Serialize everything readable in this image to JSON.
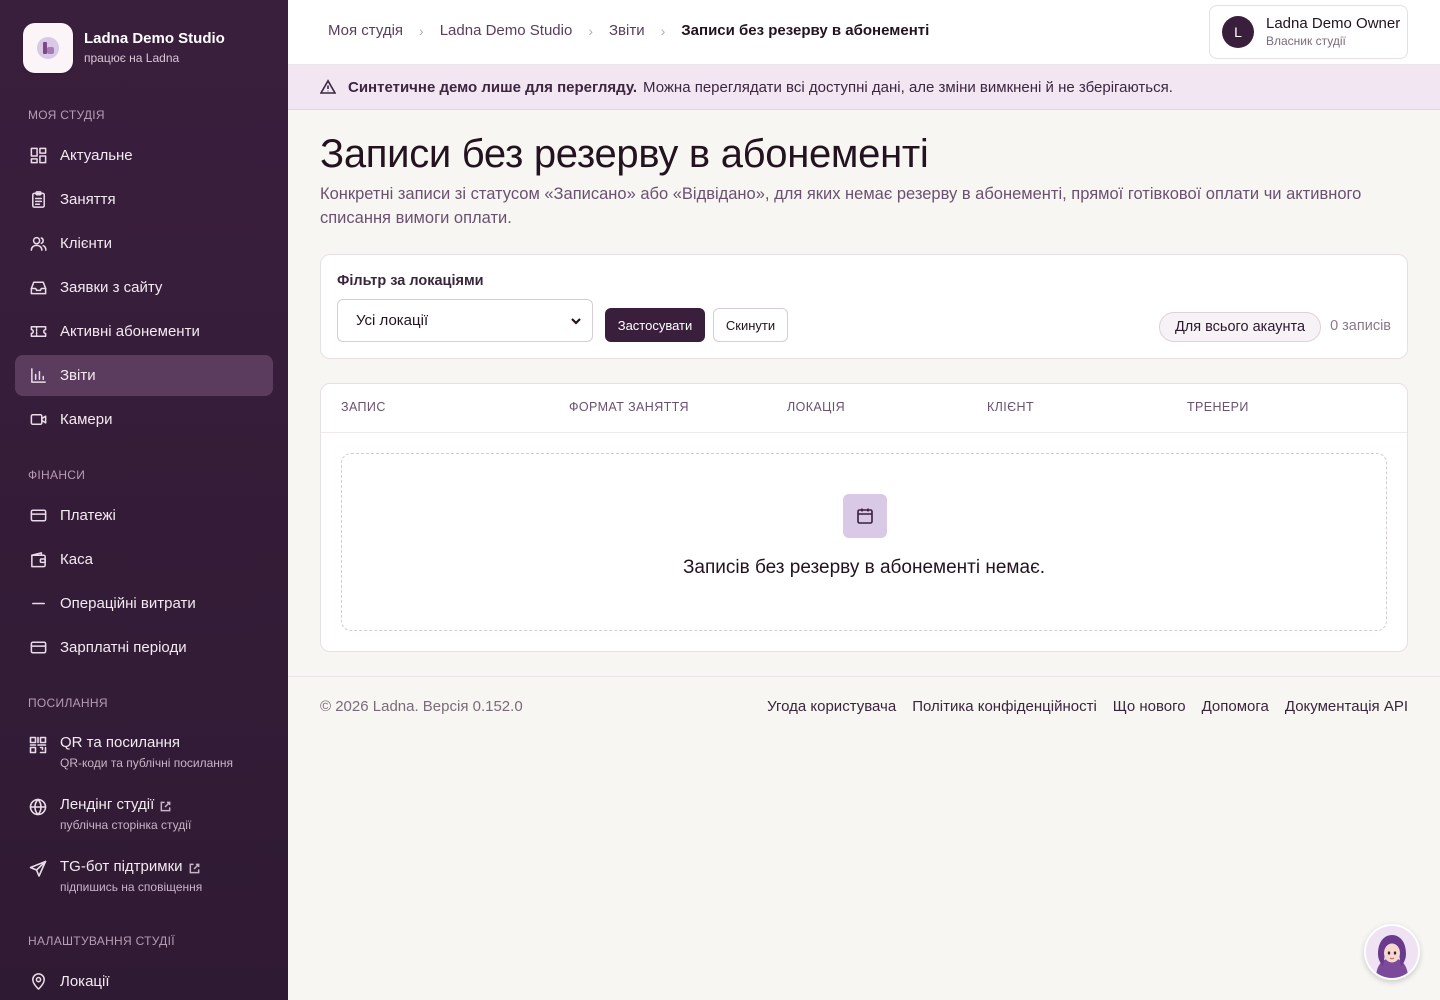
{
  "brand": {
    "name": "Ladna Demo Studio",
    "subtitle": "працює на Ladna"
  },
  "sidebar": {
    "sections": [
      {
        "title": "Моя студія"
      },
      {
        "title": "Фінанси"
      },
      {
        "title": "Посилання"
      },
      {
        "title": "Налаштування студії"
      }
    ],
    "items": [
      {
        "label": "Актуальне",
        "icon": "dashboard-icon"
      },
      {
        "label": "Заняття",
        "icon": "clipboard-icon"
      },
      {
        "label": "Клієнти",
        "icon": "users-icon"
      },
      {
        "label": "Заявки з сайту",
        "icon": "inbox-icon"
      },
      {
        "label": "Активні абонементи",
        "icon": "ticket-icon"
      },
      {
        "label": "Звіти",
        "icon": "bar-chart-icon",
        "active": true
      },
      {
        "label": "Камери",
        "icon": "video-icon"
      },
      {
        "label": "Платежі",
        "icon": "credit-card-icon"
      },
      {
        "label": "Каса",
        "icon": "wallet-icon"
      },
      {
        "label": "Операційні витрати",
        "icon": "minus-icon"
      },
      {
        "label": "Зарплатні періоди",
        "icon": "card-icon"
      },
      {
        "label": "Локації",
        "icon": "map-pin-icon"
      }
    ],
    "links": [
      {
        "label": "QR та посилання",
        "sub": "QR-коди та публічні посилання",
        "icon": "qr-icon"
      },
      {
        "label": "Лендінг студії",
        "sub": "публічна сторінка студії",
        "icon": "globe-icon"
      },
      {
        "label": "TG-бот підтримки",
        "sub": "підпишись на сповіщення",
        "icon": "send-icon"
      }
    ]
  },
  "breadcrumbs": [
    "Моя студія",
    "Ladna Demo Studio",
    "Звіти",
    "Записи без резерву в абонементі"
  ],
  "user": {
    "initial": "L",
    "name": "Ladna Demo Owner",
    "role": "Власник студії"
  },
  "banner": {
    "bold": "Синтетичне демо лише для перегляду.",
    "text": "Можна переглядати всі доступні дані, але зміни вимкнені й не зберігаються."
  },
  "page": {
    "title": "Записи без резерву в абонементі",
    "description": "Конкретні записи зі статусом «Записано» або «Відвідано», для яких немає резерву в абонементі, прямої готівкової оплати чи активного списання вимоги оплати."
  },
  "filter": {
    "label": "Фільтр за локаціями",
    "select_value": "Усі локації",
    "apply_label": "Застосувати",
    "reset_label": "Скинути",
    "scope_badge": "Для всього акаунта",
    "count": "0 записів"
  },
  "table": {
    "columns": [
      "Запис",
      "Формат заняття",
      "Локація",
      "Клієнт",
      "Тренери"
    ],
    "empty_text": "Записів без резерву в абонементі немає."
  },
  "footer": {
    "copyright": "© 2026 Ladna. Версія 0.152.0",
    "links": [
      "Угода користувача",
      "Політика конфіденційності",
      "Що нового",
      "Допомога",
      "Документація API"
    ]
  },
  "colors": {
    "sidebar": "#3a1f3d",
    "accent": "#3a1f3d",
    "banner": "#f1e6f2"
  }
}
